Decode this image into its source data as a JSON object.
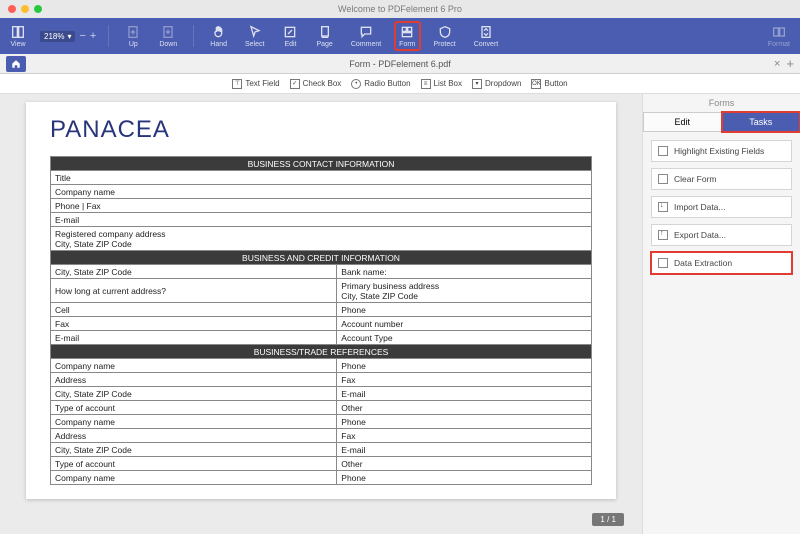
{
  "window": {
    "title": "Welcome to PDFelement 6 Pro"
  },
  "toolbar": {
    "zoom_value": "218%",
    "items": [
      {
        "key": "view",
        "label": "View"
      },
      {
        "key": "zoom",
        "label": "Zoom"
      },
      {
        "key": "up",
        "label": "Up"
      },
      {
        "key": "down",
        "label": "Down"
      },
      {
        "key": "hand",
        "label": "Hand"
      },
      {
        "key": "select",
        "label": "Select"
      },
      {
        "key": "edit",
        "label": "Edit"
      },
      {
        "key": "page",
        "label": "Page"
      },
      {
        "key": "comment",
        "label": "Comment"
      },
      {
        "key": "form",
        "label": "Form",
        "highlighted": true
      },
      {
        "key": "protect",
        "label": "Protect"
      },
      {
        "key": "convert",
        "label": "Convert"
      },
      {
        "key": "format",
        "label": "Format"
      }
    ]
  },
  "tab": {
    "filename": "Form - PDFelement 6.pdf"
  },
  "form_tools": [
    {
      "key": "textfield",
      "label": "Text Field"
    },
    {
      "key": "checkbox",
      "label": "Check Box"
    },
    {
      "key": "radio",
      "label": "Radio Button"
    },
    {
      "key": "listbox",
      "label": "List Box"
    },
    {
      "key": "dropdown",
      "label": "Dropdown"
    },
    {
      "key": "button",
      "label": "Button"
    }
  ],
  "document": {
    "heading": "PANACEA",
    "page_indicator": "1 / 1",
    "sections": {
      "s1_title": "BUSINESS CONTACT INFORMATION",
      "s1_rows": [
        "Title",
        "Company name",
        "Phone | Fax",
        "E-mail",
        "Registered company address\nCity, State ZIP Code"
      ],
      "s2_title": "BUSINESS AND CREDIT INFORMATION",
      "s2_rows": [
        [
          "City, State ZIP Code",
          "Bank name:"
        ],
        [
          "How long at current address?",
          "Primary business address\nCity, State ZIP Code"
        ],
        [
          "Cell",
          "Phone"
        ],
        [
          "Fax",
          "Account number"
        ],
        [
          "E-mail",
          "Account Type"
        ]
      ],
      "s3_title": "BUSINESS/TRADE REFERENCES",
      "s3_rows": [
        [
          "Company name",
          "Phone"
        ],
        [
          "Address",
          "Fax"
        ],
        [
          "City, State ZIP Code",
          "E-mail"
        ],
        [
          "Type of account",
          "Other"
        ],
        [
          "Company name",
          "Phone"
        ],
        [
          "Address",
          "Fax"
        ],
        [
          "City, State ZIP Code",
          "E-mail"
        ],
        [
          "Type of account",
          "Other"
        ],
        [
          "Company name",
          "Phone"
        ]
      ]
    }
  },
  "side_panel": {
    "header": "Forms",
    "tabs": {
      "edit": "Edit",
      "tasks": "Tasks"
    },
    "active_tab": "tasks",
    "tasks": [
      {
        "key": "highlight",
        "label": "Highlight Existing Fields"
      },
      {
        "key": "clear",
        "label": "Clear Form"
      },
      {
        "key": "import",
        "label": "Import Data..."
      },
      {
        "key": "export",
        "label": "Export Data..."
      },
      {
        "key": "extract",
        "label": "Data Extraction",
        "highlighted": true
      }
    ]
  }
}
